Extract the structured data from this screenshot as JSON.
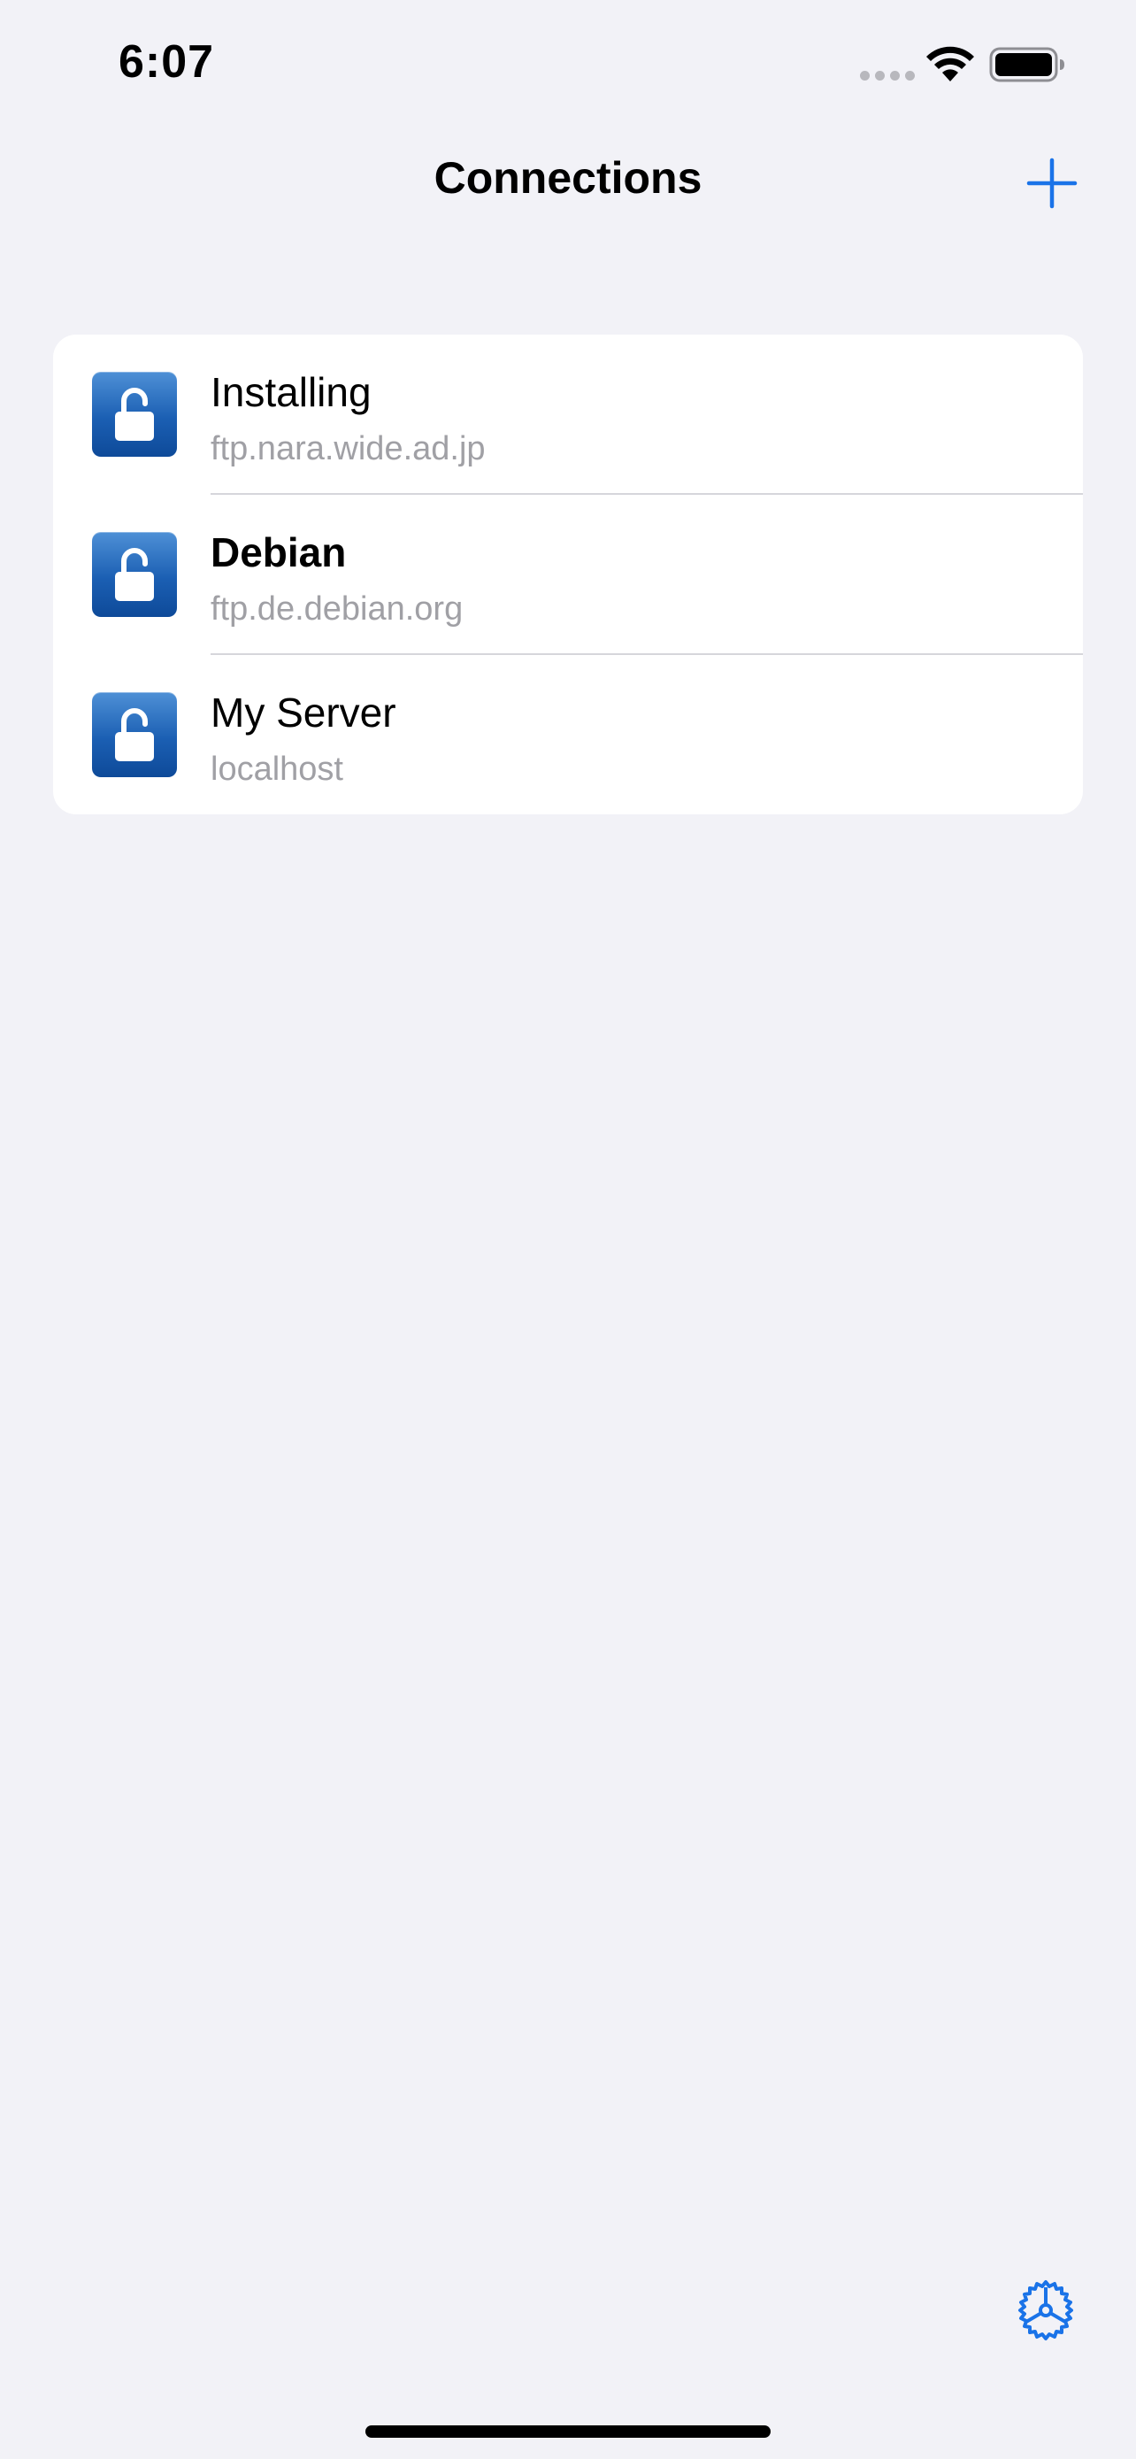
{
  "status_bar": {
    "time": "6:07"
  },
  "nav": {
    "title": "Connections",
    "add_icon": "plus-icon"
  },
  "connections": [
    {
      "name": "Installing",
      "host": "ftp.nara.wide.ad.jp",
      "icon": "unlocked-padlock-icon",
      "bold": false
    },
    {
      "name": "Debian",
      "host": "ftp.de.debian.org",
      "icon": "unlocked-padlock-icon",
      "bold": true
    },
    {
      "name": "My Server",
      "host": "localhost",
      "icon": "unlocked-padlock-icon",
      "bold": false
    }
  ],
  "toolbar": {
    "settings_icon": "gear-icon"
  },
  "colors": {
    "accent": "#1a73e8",
    "background": "#f2f2f7",
    "card": "#ffffff",
    "secondary_text": "#a0a0a5",
    "icon_gradient_top": "#4e90d6",
    "icon_gradient_bottom": "#0e4a99"
  }
}
